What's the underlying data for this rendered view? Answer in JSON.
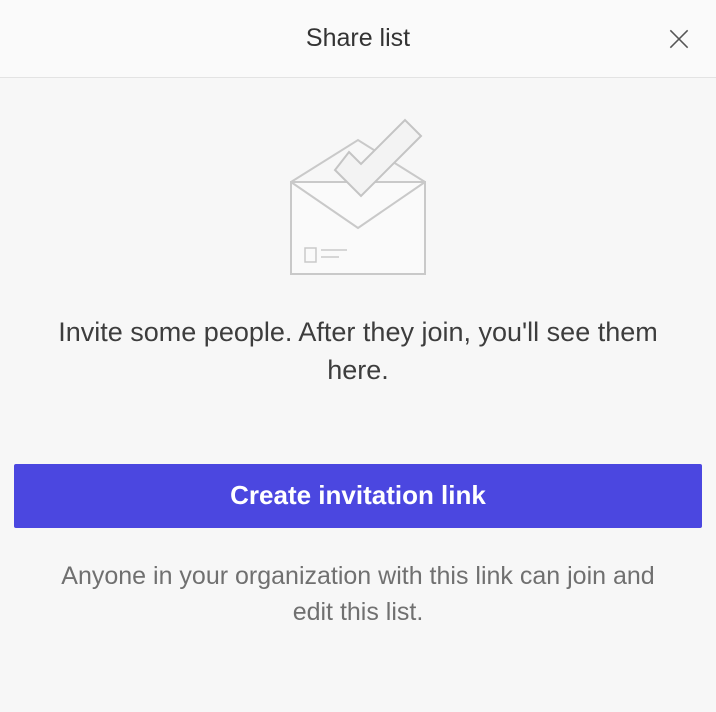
{
  "modal": {
    "title": "Share list",
    "emptyState": {
      "message": "Invite some people. After they join, you'll see them here."
    },
    "createButton": {
      "label": "Create invitation link"
    },
    "helper": "Anyone in your organization with this link can join and edit this list."
  },
  "colors": {
    "primary": "#4b47e0"
  }
}
